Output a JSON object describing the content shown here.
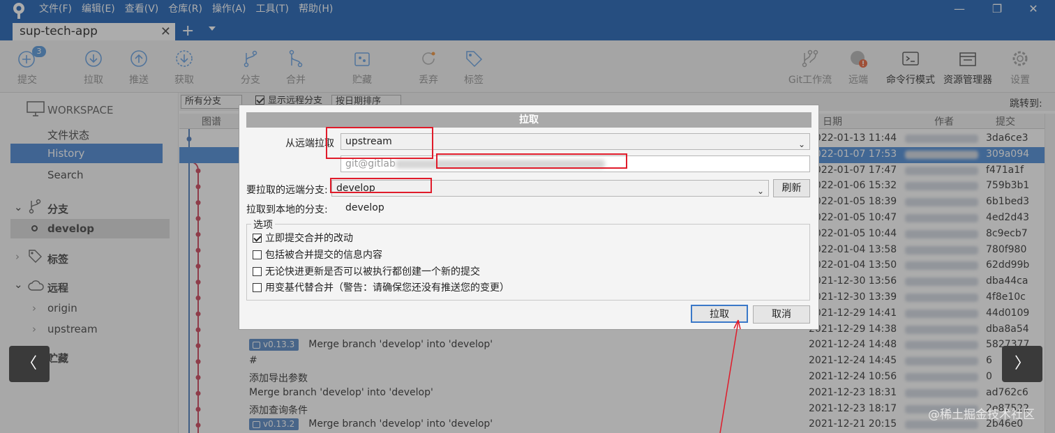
{
  "menu": [
    "文件(F)",
    "编辑(E)",
    "查看(V)",
    "仓库(R)",
    "操作(A)",
    "工具(T)",
    "帮助(H)"
  ],
  "window": {
    "minimize": "—",
    "maximize": "❐",
    "close": "✕"
  },
  "tab": {
    "title": "sup-tech-app",
    "close": "✕",
    "add": "+"
  },
  "toolbar": {
    "commit_badge": "3",
    "commit": "提交",
    "pull": "拉取",
    "push": "推送",
    "fetch": "获取",
    "branch": "分支",
    "merge": "合并",
    "stash": "贮藏",
    "discard": "丢弃",
    "tag": "标签",
    "gitflow": "Git工作流",
    "remote": "远端",
    "terminal": "命令行模式",
    "explorer": "资源管理器",
    "settings": "设置"
  },
  "sidebar": {
    "workspace": "WORKSPACE",
    "file_status": "文件状态",
    "history": "History",
    "search": "Search",
    "branches": "分支",
    "develop": "develop",
    "tags": "标签",
    "remotes": "远程",
    "origin": "origin",
    "upstream": "upstream",
    "stash": "贮藏"
  },
  "filter": {
    "branches": "所有分支",
    "show_remote": "显示远程分支",
    "sort": "按日期排序",
    "jump": "跳转到:"
  },
  "columns": {
    "graph": "图谱",
    "date": "日期",
    "author": "作者",
    "commit": "提交"
  },
  "rows": [
    {
      "msg": "",
      "date": "2022-01-13 11:44",
      "hash": "3da6ce3"
    },
    {
      "msg": "",
      "date": "2022-01-07 17:53",
      "hash": "309a094"
    },
    {
      "msg": "",
      "date": "2022-01-07 17:47",
      "hash": "f471a1f"
    },
    {
      "msg": "",
      "date": "2022-01-06 15:32",
      "hash": "759b3b1"
    },
    {
      "msg": "",
      "date": "2022-01-05 18:39",
      "hash": "6b1bed3"
    },
    {
      "msg": "",
      "date": "2022-01-05 10:47",
      "hash": "4ed2d43"
    },
    {
      "msg": "",
      "date": "2022-01-05 10:44",
      "hash": "8c9ecb7"
    },
    {
      "msg": "",
      "date": "2022-01-04 13:58",
      "hash": "780f980"
    },
    {
      "msg": "",
      "date": "2022-01-04 13:50",
      "hash": "62dd99b"
    },
    {
      "msg": "",
      "date": "2021-12-30 13:56",
      "hash": "dba44ca"
    },
    {
      "msg": "",
      "date": "2021-12-30 13:39",
      "hash": "4f8e10c"
    },
    {
      "msg": "",
      "date": "2021-12-29 14:41",
      "hash": "44d0109"
    },
    {
      "msg": "",
      "date": "2021-12-29 14:38",
      "hash": "dba8a54"
    },
    {
      "tag": "v0.13.3",
      "msg": "Merge branch 'develop' into 'develop'",
      "date": "2021-12-24 14:48",
      "hash": "5827377"
    },
    {
      "msg": "#",
      "date": "2021-12-24 14:45",
      "hash": "6"
    },
    {
      "msg": "添加导出参数",
      "date": "2021-12-24 10:56",
      "hash": "0"
    },
    {
      "msg": "Merge branch 'develop' into 'develop'",
      "date": "2021-12-23 18:31",
      "hash": "ad762c6"
    },
    {
      "msg": "添加查询条件",
      "date": "2021-12-23 18:17",
      "hash": "2e87522"
    },
    {
      "tag": "v0.13.2",
      "msg": "Merge branch 'develop' into 'develop'",
      "date": "2021-12-21 20:15",
      "hash": "2b46e0"
    }
  ],
  "dialog": {
    "title": "拉取",
    "remote_label": "从远端拉取",
    "remote_value": "upstream",
    "url_value": "git@gitlab",
    "branch_label": "要拉取的远端分支:",
    "branch_value": "develop",
    "refresh": "刷新",
    "local_label": "拉取到本地的分支:",
    "local_value": "develop",
    "options_label": "选项",
    "opt1": "立即提交合并的改动",
    "opt2": "包括被合并提交的信息内容",
    "opt3": "无论快进更新是否可以被执行都创建一个新的提交",
    "opt4": "用变基代替合并（警告：请确保您还没有推送您的变更）",
    "ok": "拉取",
    "cancel": "取消"
  },
  "nav": {
    "prev": "〈",
    "next": "〉"
  },
  "watermark": "@稀土掘金技术社区"
}
